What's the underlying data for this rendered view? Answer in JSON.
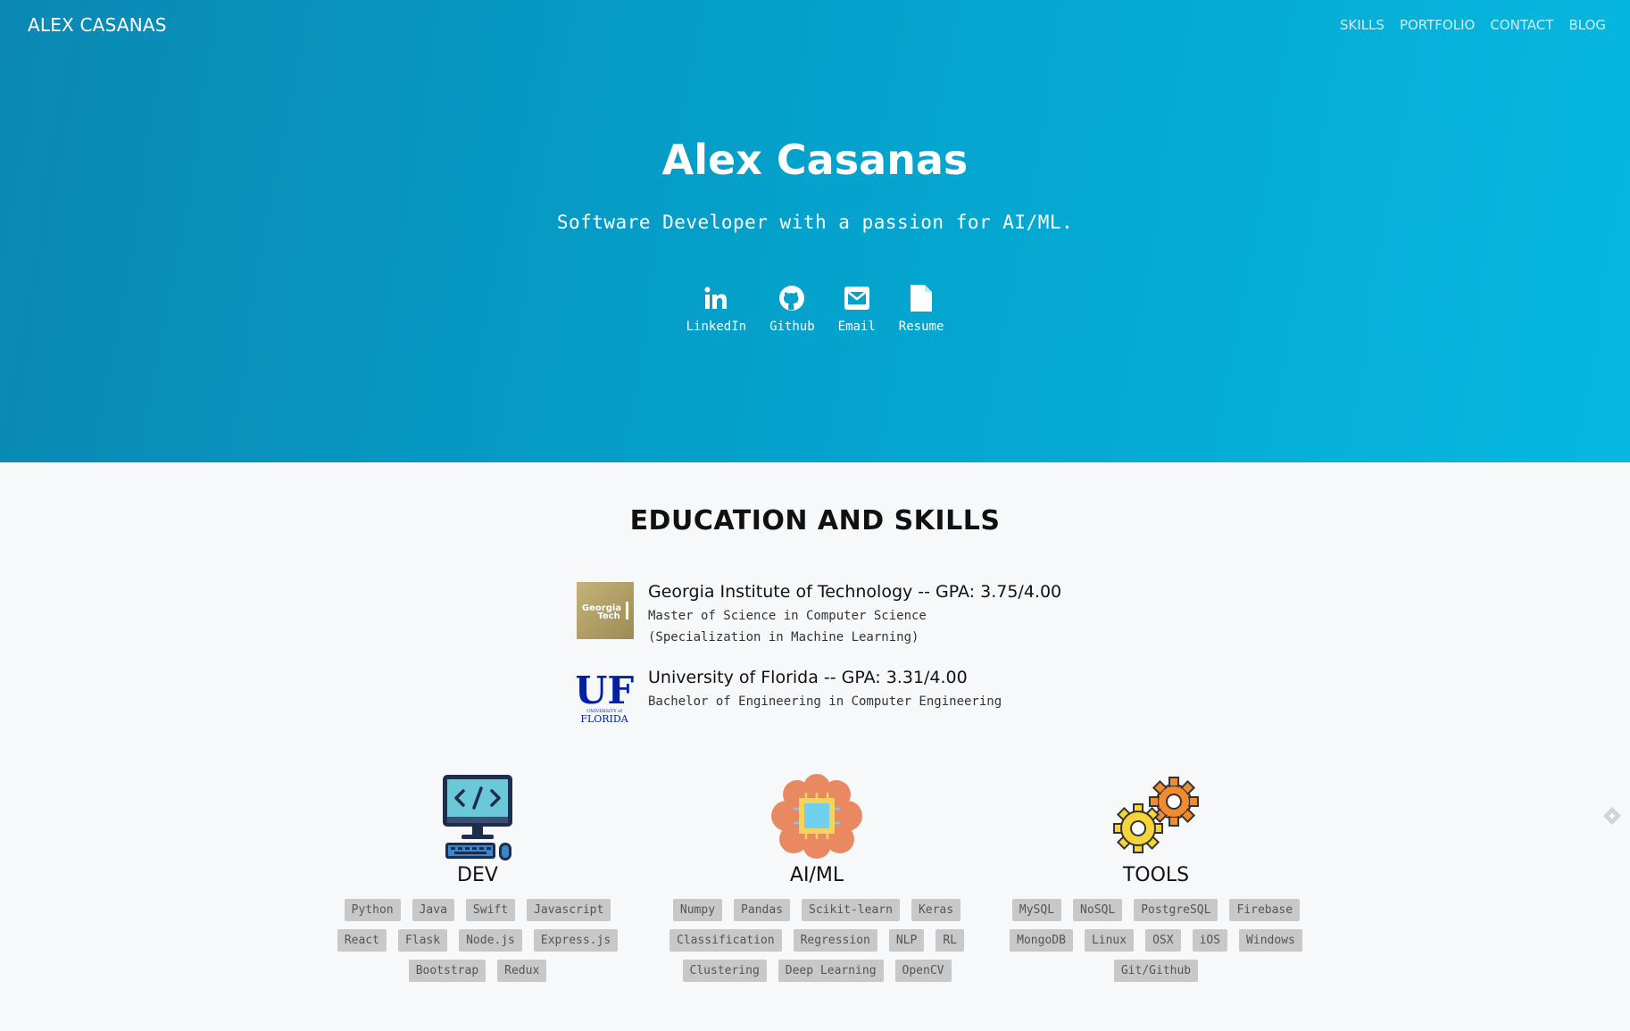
{
  "header": {
    "brand": "ALEX CASANAS",
    "nav": [
      "SKILLS",
      "PORTFOLIO",
      "CONTACT",
      "BLOG"
    ]
  },
  "hero": {
    "title": "Alex Casanas",
    "subtitle": "Software Developer with a passion for AI/ML.",
    "links": [
      {
        "label": "LinkedIn",
        "icon": "linkedin-icon"
      },
      {
        "label": "Github",
        "icon": "github-icon"
      },
      {
        "label": "Email",
        "icon": "email-icon"
      },
      {
        "label": "Resume",
        "icon": "document-icon"
      }
    ]
  },
  "education": {
    "title": "EDUCATION AND SKILLS",
    "schools": [
      {
        "name": "Georgia Institute of Technology -- GPA: 3.75/4.00",
        "detail1": "Master of Science in Computer Science",
        "detail2": "(Specialization in Machine Learning)",
        "logo_text1": "Georgia",
        "logo_text2": "Tech"
      },
      {
        "name": "University of Florida -- GPA: 3.31/4.00",
        "detail1": "Bachelor of Engineering in Computer Engineering",
        "logo_text1": "UF",
        "logo_text2": "UNIVERSITY of",
        "logo_text3": "FLORIDA"
      }
    ]
  },
  "skills": {
    "dev": {
      "title": "DEV",
      "tags": [
        "Python",
        "Java",
        "Swift",
        "Javascript",
        "React",
        "Flask",
        "Node.js",
        "Express.js",
        "Bootstrap",
        "Redux"
      ]
    },
    "aiml": {
      "title": "AI/ML",
      "tags": [
        "Numpy",
        "Pandas",
        "Scikit-learn",
        "Keras",
        "Classification",
        "Regression",
        "NLP",
        "RL",
        "Clustering",
        "Deep Learning",
        "OpenCV"
      ]
    },
    "tools": {
      "title": "TOOLS",
      "tags": [
        "MySQL",
        "NoSQL",
        "PostgreSQL",
        "Firebase",
        "MongoDB",
        "Linux",
        "OSX",
        "iOS",
        "Windows",
        "Git/Github"
      ]
    }
  },
  "colors": {
    "hero_start": "#0a88b3",
    "hero_end": "#06b8e0",
    "tag_bg": "#c8c8c8",
    "gt_gold": "#b3a369",
    "uf_blue": "#0021a5"
  }
}
